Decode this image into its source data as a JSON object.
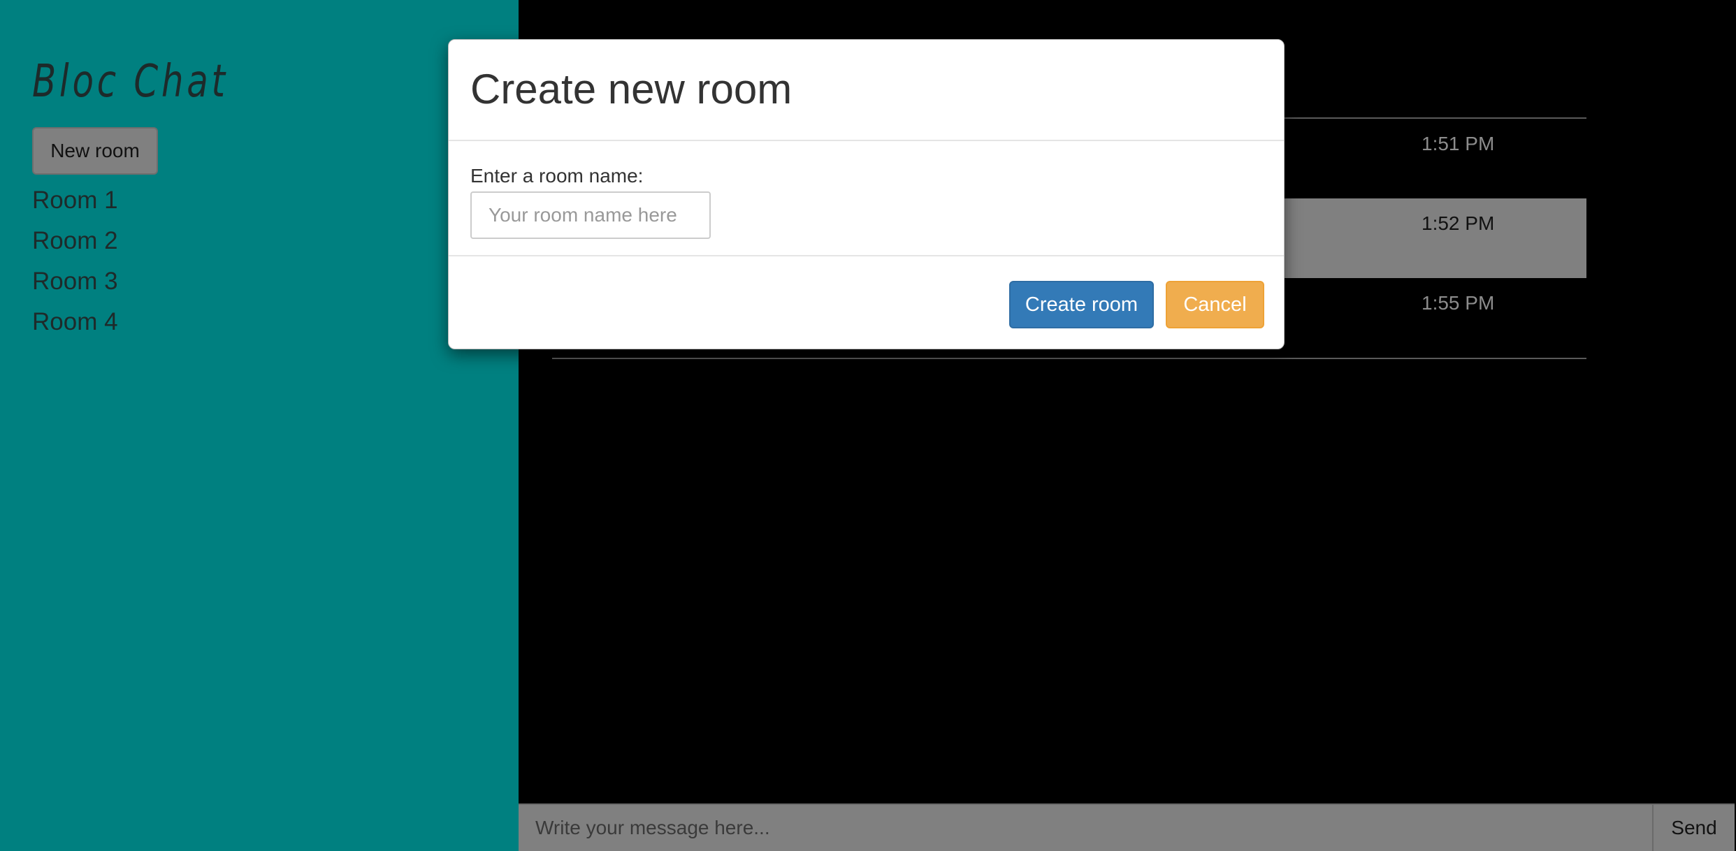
{
  "sidebar": {
    "brand": "Bloc Chat",
    "new_room_label": "New room",
    "rooms": [
      "Room 1",
      "Room 2",
      "Room 3",
      "Room 4"
    ]
  },
  "messages": [
    {
      "time": "1:51 PM",
      "highlighted": false
    },
    {
      "time": "1:52 PM",
      "highlighted": true
    },
    {
      "time": "1:55 PM",
      "highlighted": false
    }
  ],
  "composer": {
    "placeholder": "Write your message here...",
    "send_label": "Send"
  },
  "modal": {
    "title": "Create new room",
    "field_label": "Enter a room name:",
    "input_placeholder": "Your room name here",
    "create_label": "Create room",
    "cancel_label": "Cancel"
  },
  "colors": {
    "sidebar_bg": "#008080",
    "main_bg": "#000000",
    "primary_button": "#337ab7",
    "warning_button": "#f0ad4e",
    "highlight_row": "#808080"
  }
}
